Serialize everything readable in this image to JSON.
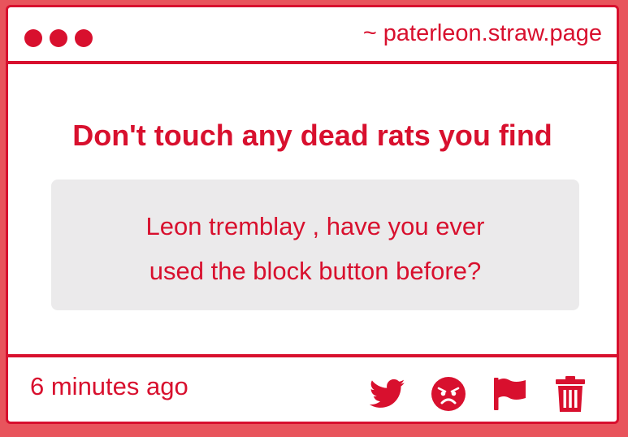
{
  "colors": {
    "accent": "#d8102e",
    "background": "#e8545c",
    "card": "#ffffff",
    "message_bg": "#ebeaeb"
  },
  "header": {
    "url_prefix": "~",
    "url": "paterleon.straw.page"
  },
  "post": {
    "title": "Don't touch any dead rats you find",
    "message_line1": "Leon tremblay , have you ever",
    "message_line2": "used the block button before?"
  },
  "footer": {
    "timestamp": "6 minutes ago",
    "actions": [
      "twitter-icon",
      "angry-face-icon",
      "flag-icon",
      "trash-icon"
    ]
  }
}
